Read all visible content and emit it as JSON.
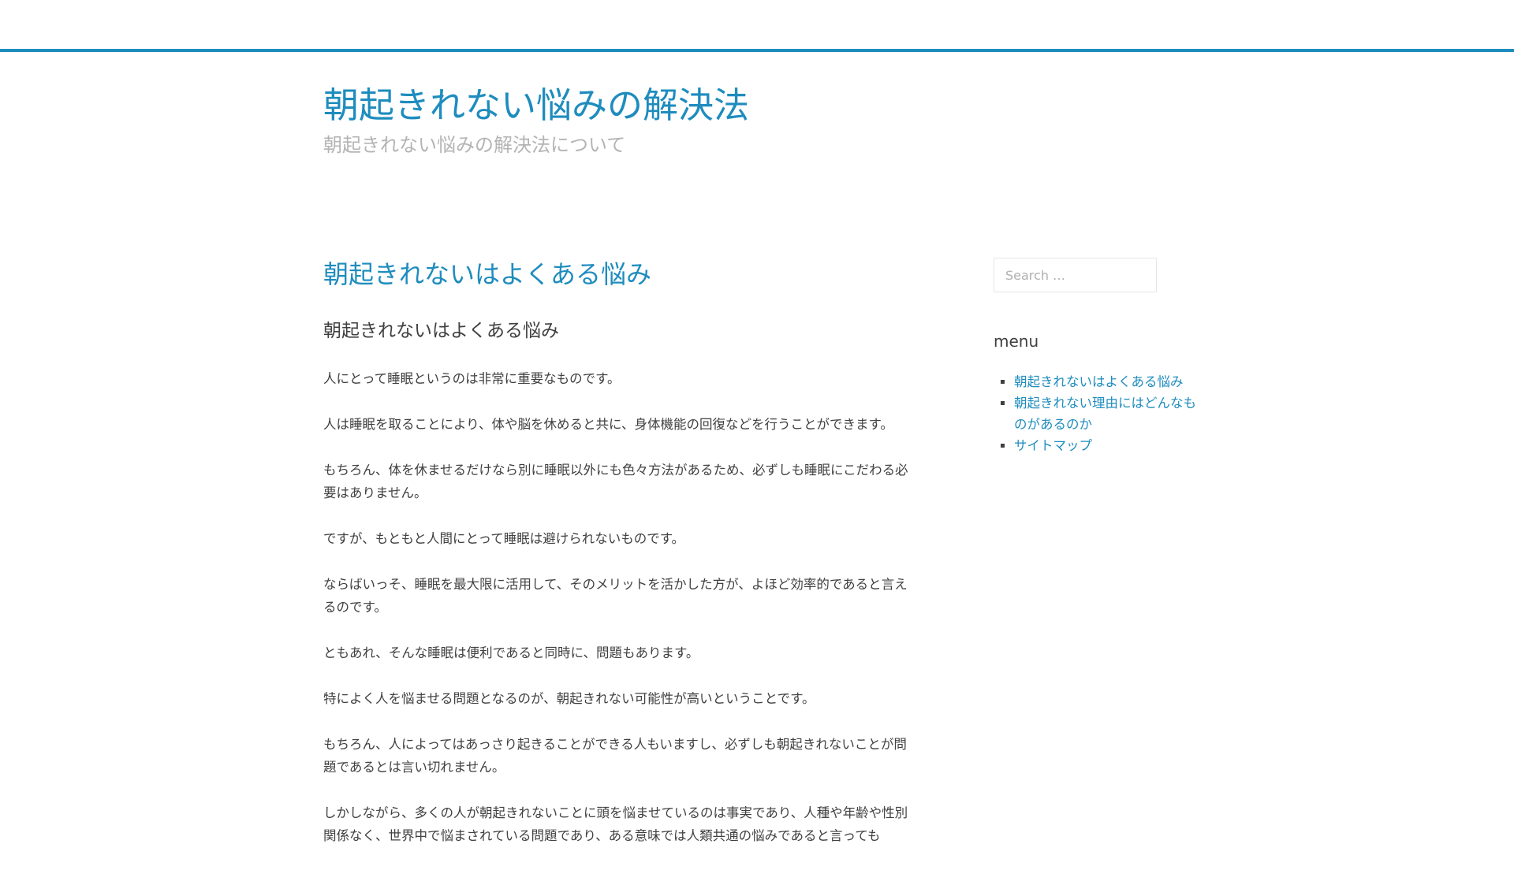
{
  "header": {
    "site_title": "朝起きれない悩みの解決法",
    "site_description": "朝起きれない悩みの解決法について"
  },
  "article": {
    "title": "朝起きれないはよくある悩み",
    "subtitle": "朝起きれないはよくある悩み",
    "paragraphs": [
      "人にとって睡眠というのは非常に重要なものです。",
      "人は睡眠を取ることにより、体や脳を休めると共に、身体機能の回復などを行うことができます。",
      "もちろん、体を休ませるだけなら別に睡眠以外にも色々方法があるため、必ずしも睡眠にこだわる必要はありません。",
      "ですが、もともと人間にとって睡眠は避けられないものです。",
      "ならばいっそ、睡眠を最大限に活用して、そのメリットを活かした方が、よほど効率的であると言えるのです。",
      "ともあれ、そんな睡眠は便利であると同時に、問題もあります。",
      "特によく人を悩ませる問題となるのが、朝起きれない可能性が高いということです。",
      "もちろん、人によってはあっさり起きることができる人もいますし、必ずしも朝起きれないことが問題であるとは言い切れません。",
      "しかしながら、多くの人が朝起きれないことに頭を悩ませているのは事実であり、人種や年齢や性別関係なく、世界中で悩まされている問題であり、ある意味では人類共通の悩みであると言っても"
    ]
  },
  "sidebar": {
    "search_placeholder": "Search …",
    "menu_title": "menu",
    "menu_items": [
      "朝起きれないはよくある悩み",
      "朝起きれない理由にはどんなものがあるのか",
      "サイトマップ"
    ]
  },
  "colors": {
    "accent": "#1e8cbe",
    "text": "#404040",
    "muted": "#b4b4b4"
  }
}
